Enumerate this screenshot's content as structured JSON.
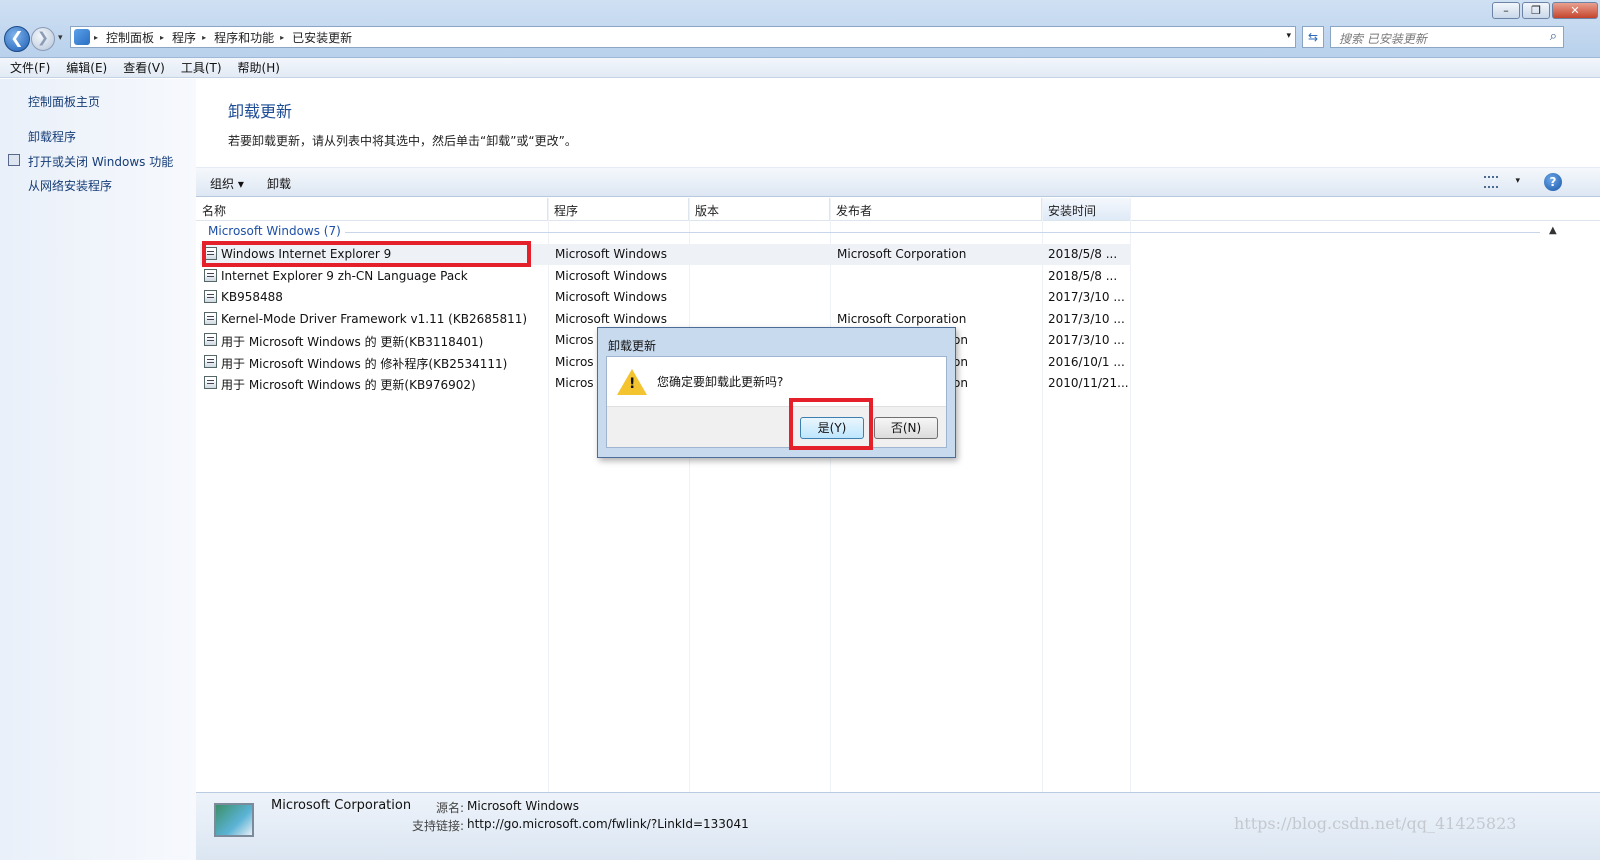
{
  "window": {
    "minimize": "–",
    "maximize": "❐",
    "close": "✕"
  },
  "nav": {
    "back": "❮",
    "forward": "❯",
    "dropdown": "▾"
  },
  "address": {
    "crumbs": [
      "控制面板",
      "程序",
      "程序和功能",
      "已安装更新"
    ],
    "separator": "▸",
    "dropdown": "▾",
    "refresh": "⇆"
  },
  "search": {
    "placeholder": "搜索 已安装更新",
    "icon": "search-icon"
  },
  "menu": [
    "文件(F)",
    "编辑(E)",
    "查看(V)",
    "工具(T)",
    "帮助(H)"
  ],
  "left_pane": {
    "home": "控制面板主页",
    "uninstall_program": "卸载程序",
    "windows_features": "打开或关闭 Windows 功能",
    "install_from_network": "从网络安装程序"
  },
  "main": {
    "title": "卸载更新",
    "description": "若要卸载更新，请从列表中将其选中，然后单击“卸载”或“更改”。"
  },
  "toolbar": {
    "organize": "组织 ▾",
    "uninstall": "卸载",
    "view_drop": "▾",
    "help": "?"
  },
  "columns": [
    "名称",
    "程序",
    "版本",
    "发布者",
    "安装时间"
  ],
  "group": {
    "name": "Microsoft Windows (7)",
    "toggle": "▲"
  },
  "rows": [
    {
      "name": "Windows Internet Explorer 9",
      "program": "Microsoft Windows",
      "version": "",
      "publisher": "Microsoft Corporation",
      "installed": "2018/5/8 ..."
    },
    {
      "name": "Internet Explorer 9 zh-CN Language Pack",
      "program": "Microsoft Windows",
      "version": "",
      "publisher": "",
      "installed": "2018/5/8 ..."
    },
    {
      "name": "KB958488",
      "program": "Microsoft Windows",
      "version": "",
      "publisher": "",
      "installed": "2017/3/10 ..."
    },
    {
      "name": "Kernel-Mode Driver Framework v1.11 (KB2685811)",
      "program": "Microsoft Windows",
      "version": "",
      "publisher": "Microsoft Corporation",
      "installed": "2017/3/10 ..."
    },
    {
      "name": "用于 Microsoft Windows 的 更新(KB3118401)",
      "program": "Micros",
      "version": "",
      "publisher": "on",
      "installed": "2017/3/10 ..."
    },
    {
      "name": "用于 Microsoft Windows 的 修补程序(KB2534111)",
      "program": "Micros",
      "version": "",
      "publisher": "on",
      "installed": "2016/10/1 ..."
    },
    {
      "name": "用于 Microsoft Windows 的 更新(KB976902)",
      "program": "Micros",
      "version": "",
      "publisher": "on",
      "installed": "2010/11/21..."
    }
  ],
  "dialog": {
    "title": "卸载更新",
    "message": "您确定要卸载此更新吗?",
    "yes": "是(Y)",
    "no": "否(N)",
    "warning_mark": "!"
  },
  "details": {
    "name": "Microsoft Corporation",
    "source_label": "源名:",
    "source_value": "Microsoft Windows",
    "link_label": "支持链接:",
    "link_value": "http://go.microsoft.com/fwlink/?LinkId=133041"
  },
  "watermark": "https://blog.csdn.net/qq_41425823",
  "colors": {
    "highlight": "#e4202b",
    "link": "#163d77",
    "group": "#1e50a8"
  }
}
